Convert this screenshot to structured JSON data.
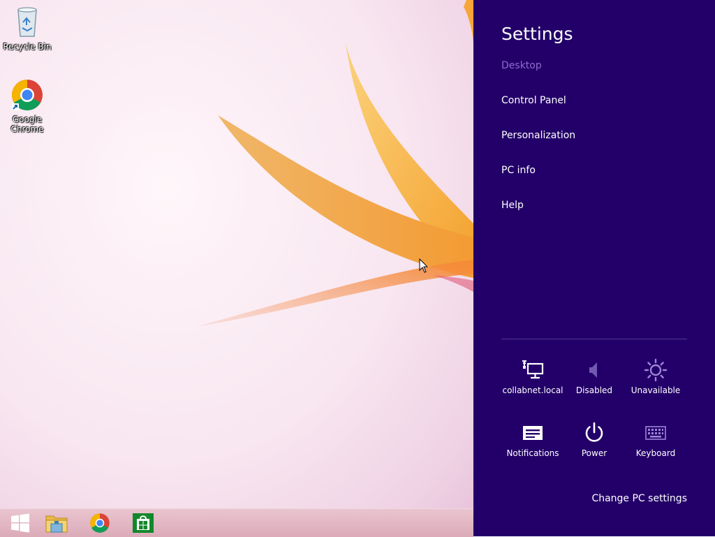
{
  "desktop": {
    "icons": [
      {
        "label": "Recycle Bin",
        "icon": "recycle-bin-icon"
      },
      {
        "label": "Google Chrome",
        "icon": "chrome-icon"
      }
    ]
  },
  "taskbar": {
    "items": [
      "windows-start-icon",
      "file-explorer-icon",
      "chrome-icon",
      "store-icon"
    ]
  },
  "settings": {
    "title": "Settings",
    "subtitle": "Desktop",
    "menu": [
      "Control Panel",
      "Personalization",
      "PC info",
      "Help"
    ],
    "tiles": [
      {
        "label": "collabnet.local",
        "icon": "network-icon"
      },
      {
        "label": "Disabled",
        "icon": "volume-icon"
      },
      {
        "label": "Unavailable",
        "icon": "brightness-icon"
      },
      {
        "label": "Notifications",
        "icon": "notifications-icon"
      },
      {
        "label": "Power",
        "icon": "power-icon"
      },
      {
        "label": "Keyboard",
        "icon": "keyboard-icon"
      }
    ],
    "footer_link": "Change PC settings"
  },
  "colors": {
    "charm_background": "#230069",
    "dimmed_text": "#8d6cd0",
    "flower_orange": "#f5a93c"
  }
}
